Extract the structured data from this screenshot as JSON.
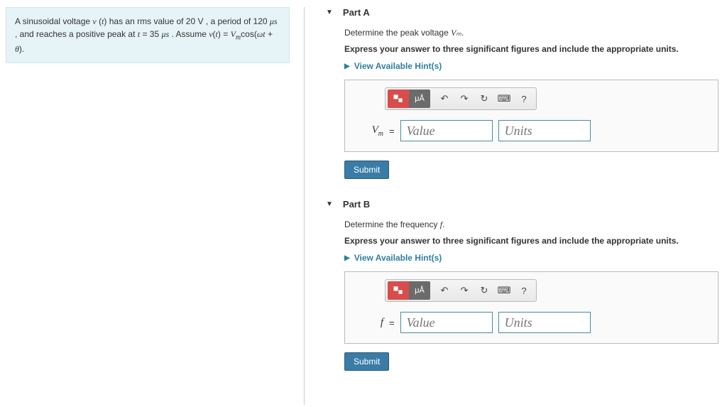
{
  "problem": {
    "text_part1": "A sinusoidal voltage ",
    "var_v": "v",
    "text_part2": "(t) has an rms value of 20 V , a period of 120 μs , and reaches a positive peak at t = 35 μs . Assume v(t) = ",
    "formula": "Vₘcos(ωt + θ)."
  },
  "parts": [
    {
      "title": "Part A",
      "determine_prefix": "Determine the peak voltage ",
      "determine_var": "Vₘ",
      "determine_suffix": ".",
      "instruction": "Express your answer to three significant figures and include the appropriate units.",
      "hint_label": "View Available Hint(s)",
      "var_label_html": "V<sub>m</sub>",
      "value_placeholder": "Value",
      "units_placeholder": "Units",
      "submit_label": "Submit"
    },
    {
      "title": "Part B",
      "determine_prefix": "Determine the frequency ",
      "determine_var": "f",
      "determine_suffix": ".",
      "instruction": "Express your answer to three significant figures and include the appropriate units.",
      "hint_label": "View Available Hint(s)",
      "var_label_html": "f",
      "value_placeholder": "Value",
      "units_placeholder": "Units",
      "submit_label": "Submit"
    }
  ],
  "toolbar": {
    "template_btn": "▫▫",
    "special_char": "μÅ",
    "undo": "↶",
    "redo": "↷",
    "reset": "↻",
    "keyboard": "⌨",
    "help": "?"
  }
}
